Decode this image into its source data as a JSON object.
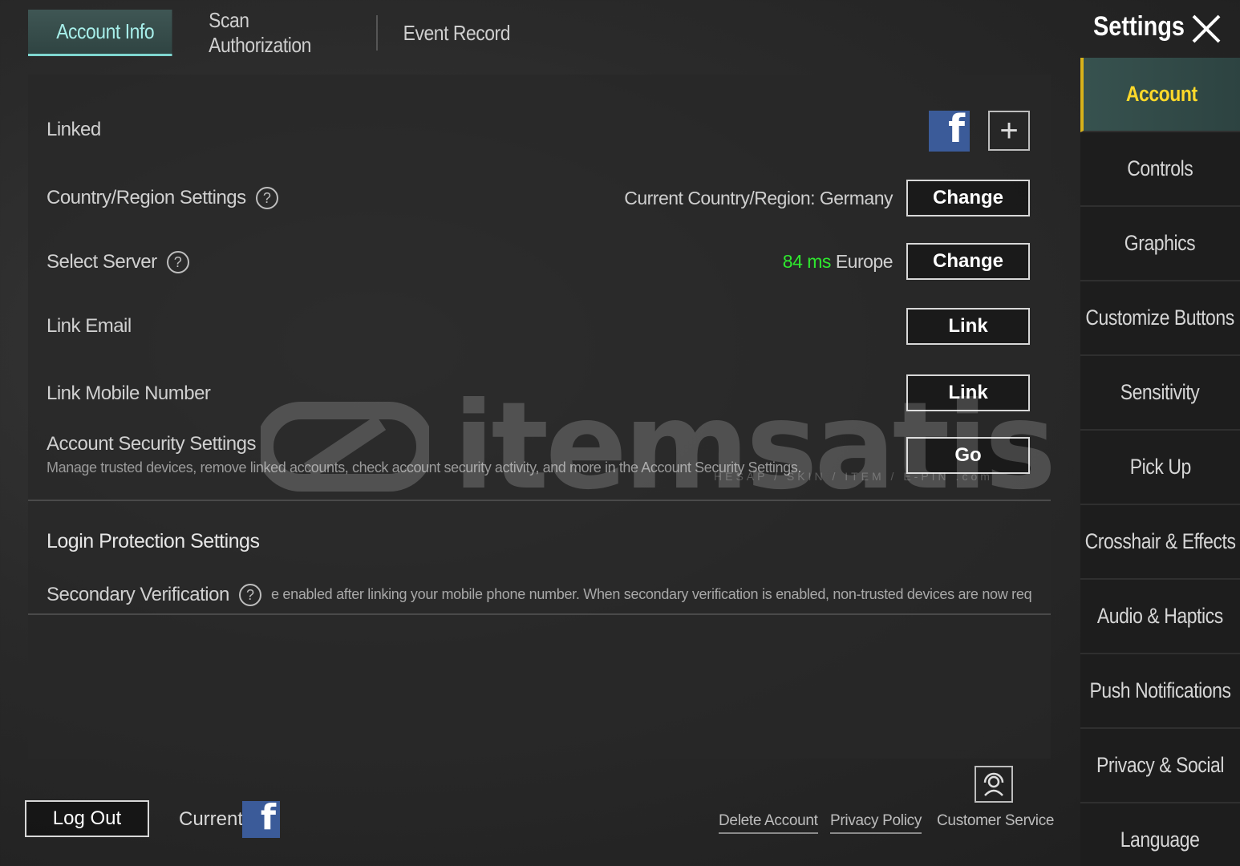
{
  "tabs": [
    {
      "label": "Account Info",
      "active": true
    },
    {
      "label": "Scan Authorization",
      "active": false
    },
    {
      "label": "Event Record",
      "active": false
    }
  ],
  "settings_title": "Settings",
  "linked": {
    "label": "Linked",
    "facebook_glyph": "f",
    "add_glyph": "+"
  },
  "country": {
    "label": "Country/Region Settings",
    "current": "Current Country/Region: Germany",
    "button": "Change"
  },
  "server": {
    "label": "Select Server",
    "ping": "84 ms",
    "region": "Europe",
    "ping_color": "#2ee82e",
    "button": "Change"
  },
  "email": {
    "label": "Link Email",
    "button": "Link"
  },
  "mobile": {
    "label": "Link Mobile Number",
    "button": "Link"
  },
  "security": {
    "label": "Account Security Settings",
    "description": "Manage trusted devices, remove linked accounts, check account security activity, and more in the Account Security Settings.",
    "button": "Go"
  },
  "login_protection": {
    "title": "Login Protection Settings",
    "secondary_label": "Secondary Verification",
    "secondary_text": "e enabled after linking your mobile phone number. When secondary verification is enabled, non-trusted devices are now req"
  },
  "watermark": {
    "brand": "itemsatis",
    "tagline": "HESAP / SKIN / ITEM / E-PIN .com"
  },
  "sidebar": [
    {
      "label": "Account",
      "active": true
    },
    {
      "label": "Controls"
    },
    {
      "label": "Graphics"
    },
    {
      "label": "Customize Buttons"
    },
    {
      "label": "Sensitivity"
    },
    {
      "label": "Pick Up"
    },
    {
      "label": "Crosshair & Effects"
    },
    {
      "label": "Audio & Haptics"
    },
    {
      "label": "Push Notifications"
    },
    {
      "label": "Privacy & Social"
    },
    {
      "label": "Language"
    }
  ],
  "footer": {
    "logout": "Log Out",
    "current": "Current",
    "delete_account": "Delete Account",
    "privacy_policy": "Privacy Policy",
    "customer_service": "Customer Service"
  },
  "colors": {
    "accent": "#ffd92a",
    "active_tab_text": "#a7efea",
    "facebook": "#3b5b99"
  }
}
